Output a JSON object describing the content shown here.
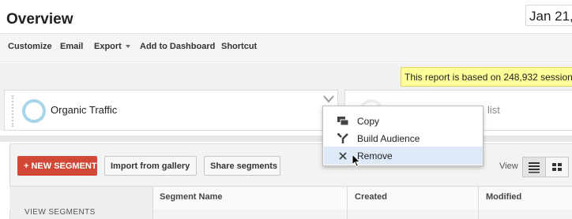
{
  "header": {
    "title": "Overview",
    "date": "Jan 21,"
  },
  "toolbar": {
    "customize": "Customize",
    "email": "Email",
    "export": "Export",
    "add_to_dashboard": "Add to Dashboard",
    "shortcut": "Shortcut"
  },
  "notice": "This report is based on 248,932 sessions",
  "segments": {
    "primary": "Organic Traffic",
    "secondary_partial": "list"
  },
  "context_menu": {
    "items": [
      {
        "label": "Copy",
        "icon": "copy-icon"
      },
      {
        "label": "Build Audience",
        "icon": "build-audience-icon"
      },
      {
        "label": "Remove",
        "icon": "close-icon"
      }
    ]
  },
  "panel": {
    "new_segment": "+ NEW SEGMENT",
    "import": "Import from gallery",
    "share": "Share segments",
    "view_label": "View",
    "columns": [
      "Segment Name",
      "Created",
      "Modified"
    ],
    "view_segments": "VIEW SEGMENTS"
  },
  "colors": {
    "accent_red": "#d14836",
    "notice_yellow": "#ffff99",
    "ring_blue": "#a9d5ea",
    "menu_hover": "#dde9f7"
  }
}
